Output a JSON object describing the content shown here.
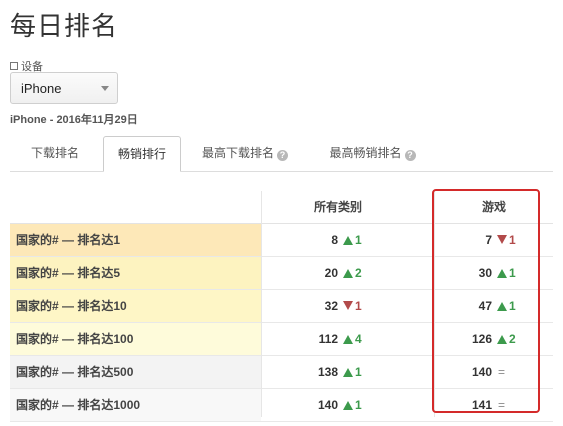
{
  "page": {
    "title": "每日排名"
  },
  "device": {
    "label": "设备",
    "selected": "iPhone"
  },
  "date_line": "iPhone - 2016年11月29日",
  "tabs": [
    {
      "label": "下载排名",
      "active": false,
      "help": false
    },
    {
      "label": "畅销排行",
      "active": true,
      "help": false
    },
    {
      "label": "最高下载排名",
      "active": false,
      "help": true
    },
    {
      "label": "最高畅销排名",
      "active": false,
      "help": true
    }
  ],
  "table": {
    "headers": [
      "",
      "所有类别",
      "游戏"
    ],
    "rows": [
      {
        "label": "国家的# — 排名达1",
        "bg": "#fde8b8",
        "all": {
          "rank": "8",
          "dir": "up",
          "change": "1"
        },
        "game": {
          "rank": "7",
          "dir": "down",
          "change": "1"
        }
      },
      {
        "label": "国家的# — 排名达5",
        "bg": "#fdf3c0",
        "all": {
          "rank": "20",
          "dir": "up",
          "change": "2"
        },
        "game": {
          "rank": "30",
          "dir": "up",
          "change": "1"
        }
      },
      {
        "label": "国家的# — 排名达10",
        "bg": "#fef6c6",
        "all": {
          "rank": "32",
          "dir": "down",
          "change": "1"
        },
        "game": {
          "rank": "47",
          "dir": "up",
          "change": "1"
        }
      },
      {
        "label": "国家的# — 排名达100",
        "bg": "#fefbda",
        "all": {
          "rank": "112",
          "dir": "up",
          "change": "4"
        },
        "game": {
          "rank": "126",
          "dir": "up",
          "change": "2"
        }
      },
      {
        "label": "国家的# — 排名达500",
        "bg": "#f3f3f3",
        "all": {
          "rank": "138",
          "dir": "up",
          "change": "1"
        },
        "game": {
          "rank": "140",
          "dir": "eq",
          "change": "="
        }
      },
      {
        "label": "国家的# — 排名达1000",
        "bg": "#f8f8f8",
        "all": {
          "rank": "140",
          "dir": "up",
          "change": "1"
        },
        "game": {
          "rank": "141",
          "dir": "eq",
          "change": "="
        }
      }
    ]
  },
  "colors": {
    "up": "#3c9a4c",
    "down": "#b24a4a",
    "highlight": "#d42a2a"
  }
}
